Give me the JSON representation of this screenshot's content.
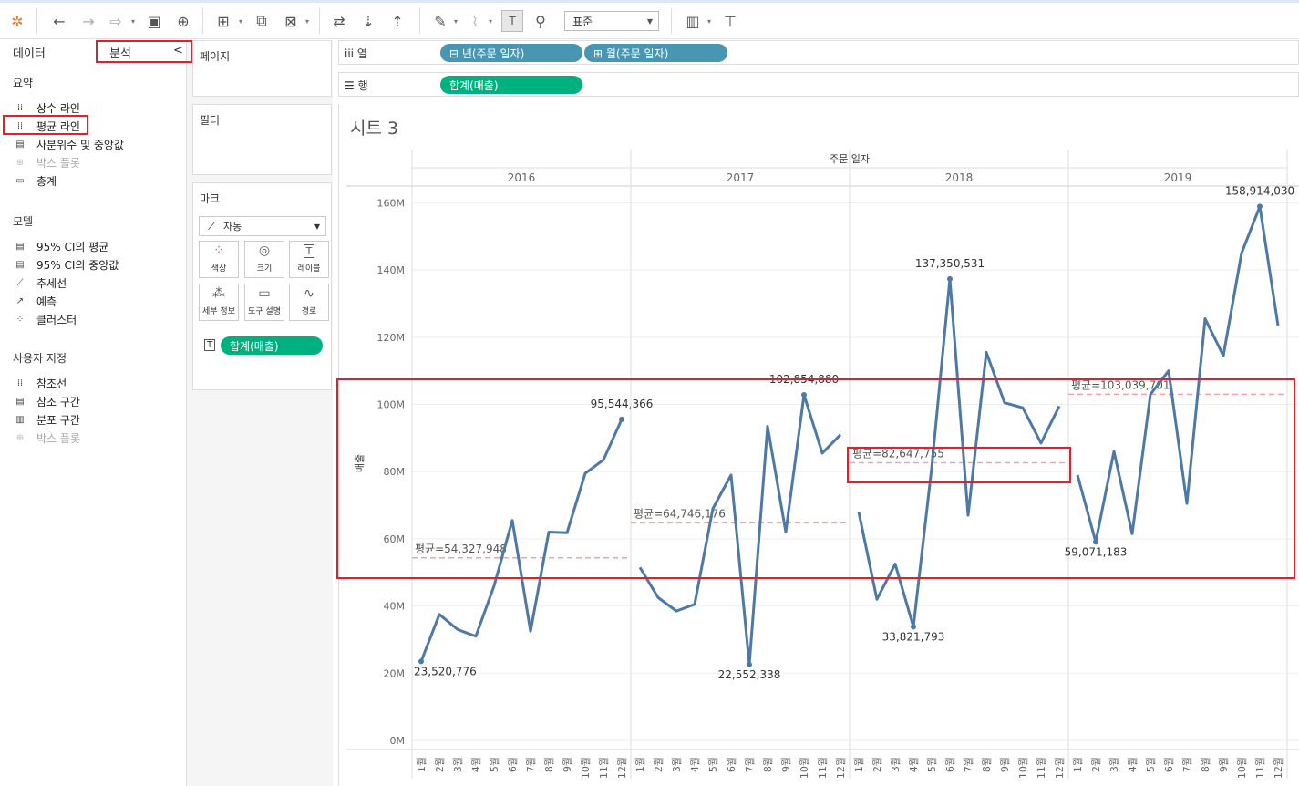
{
  "toolbar": {
    "icons": [
      "tableau-logo-icon",
      "undo-icon",
      "redo-icon",
      "replay-icon",
      "save-icon",
      "add-datasource-icon",
      "new-sheet-icon",
      "duplicate-sheet-icon",
      "clear-sheet-icon",
      "swap-icon",
      "sort-asc-icon",
      "sort-desc-icon",
      "highlight-icon",
      "attach-icon",
      "show-labels-icon",
      "pin-icon",
      "fit-dropdown",
      "show-me-icon",
      "presentation-icon"
    ],
    "fit_value": "표준"
  },
  "left_pane": {
    "tab_data": "데이터",
    "tab_analysis": "분석",
    "collapse_glyph": "<",
    "sections": {
      "summary_title": "요약",
      "summary_items": [
        {
          "label": "상수 라인",
          "enabled": true
        },
        {
          "label": "평균 라인",
          "enabled": true
        },
        {
          "label": "사분위수 및 중앙값",
          "enabled": true
        },
        {
          "label": "박스 플롯",
          "enabled": false
        },
        {
          "label": "총계",
          "enabled": true
        }
      ],
      "model_title": "모델",
      "model_items": [
        {
          "label": "95% CI의 평균",
          "enabled": true
        },
        {
          "label": "95% CI의 중앙값",
          "enabled": true
        },
        {
          "label": "추세선",
          "enabled": true
        },
        {
          "label": "예측",
          "enabled": true
        },
        {
          "label": "클러스터",
          "enabled": true
        }
      ],
      "custom_title": "사용자 지정",
      "custom_items": [
        {
          "label": "참조선",
          "enabled": true
        },
        {
          "label": "참조 구간",
          "enabled": true
        },
        {
          "label": "분포 구간",
          "enabled": true
        },
        {
          "label": "박스 플롯",
          "enabled": false
        }
      ]
    }
  },
  "cards": {
    "pages": "페이지",
    "filters": "필터",
    "marks": "마크",
    "mark_type": "자동",
    "mark_buttons": [
      "색상",
      "크기",
      "레이블",
      "세부 정보",
      "도구 설명",
      "경로"
    ],
    "label_pill": "합계(매출)"
  },
  "shelves": {
    "columns_label": "열",
    "rows_label": "행",
    "columns_pills": [
      "⊟ 년(주문 일자)",
      "⊞ 월(주문 일자)"
    ],
    "rows_pills": [
      "합계(매출)"
    ]
  },
  "sheet": {
    "title": "시트 3"
  },
  "chart_data": {
    "type": "line",
    "header": "주문 일자",
    "ylabel": "매출",
    "ylim": [
      0,
      165000000
    ],
    "yticks": [
      "0M",
      "20M",
      "40M",
      "60M",
      "80M",
      "100M",
      "120M",
      "140M",
      "160M"
    ],
    "panels": [
      {
        "year": "2016",
        "avg_label": "평균=54,327,948",
        "avg": 54327948,
        "values": [
          23520776,
          37500000,
          33000000,
          31000000,
          46000000,
          65500000,
          32500000,
          62000000,
          61800000,
          79500000,
          83500000,
          95544366
        ],
        "labels": [
          {
            "month": 1,
            "text": "23,520,776",
            "pos": "below"
          },
          {
            "month": 12,
            "text": "95,544,366",
            "pos": "above"
          }
        ]
      },
      {
        "year": "2017",
        "avg_label": "평균=64,746,176",
        "avg": 64746176,
        "values": [
          51500000,
          42500000,
          38500000,
          40500000,
          69000000,
          79000000,
          22552338,
          93500000,
          62000000,
          102854880,
          85500000,
          91000000
        ],
        "labels": [
          {
            "month": 7,
            "text": "22,552,338",
            "pos": "below"
          },
          {
            "month": 10,
            "text": "102,854,880",
            "pos": "above"
          }
        ]
      },
      {
        "year": "2018",
        "avg_label": "평균=82,647,755",
        "avg": 82647755,
        "values": [
          68000000,
          42000000,
          52500000,
          33821793,
          81000000,
          137350531,
          67000000,
          115500000,
          100500000,
          99000000,
          88500000,
          99500000
        ],
        "labels": [
          {
            "month": 4,
            "text": "33,821,793",
            "pos": "below"
          },
          {
            "month": 6,
            "text": "137,350,531",
            "pos": "above"
          }
        ]
      },
      {
        "year": "2019",
        "avg_label": "평균=103,039,701",
        "avg": 103039701,
        "values": [
          79000000,
          59071183,
          86000000,
          61500000,
          103000000,
          110000000,
          70500000,
          125500000,
          114500000,
          145000000,
          158914030,
          123500000
        ],
        "labels": [
          {
            "month": 2,
            "text": "59,071,183",
            "pos": "below"
          },
          {
            "month": 11,
            "text": "158,914,030",
            "pos": "above"
          }
        ]
      }
    ],
    "month_ticks": [
      "1",
      "2",
      "3",
      "4",
      "5",
      "6",
      "7",
      "8",
      "9",
      "10",
      "11",
      "12"
    ],
    "month_suffix": "월",
    "line_color": "#4e79a7",
    "avg_color": "#f4a3a3"
  }
}
